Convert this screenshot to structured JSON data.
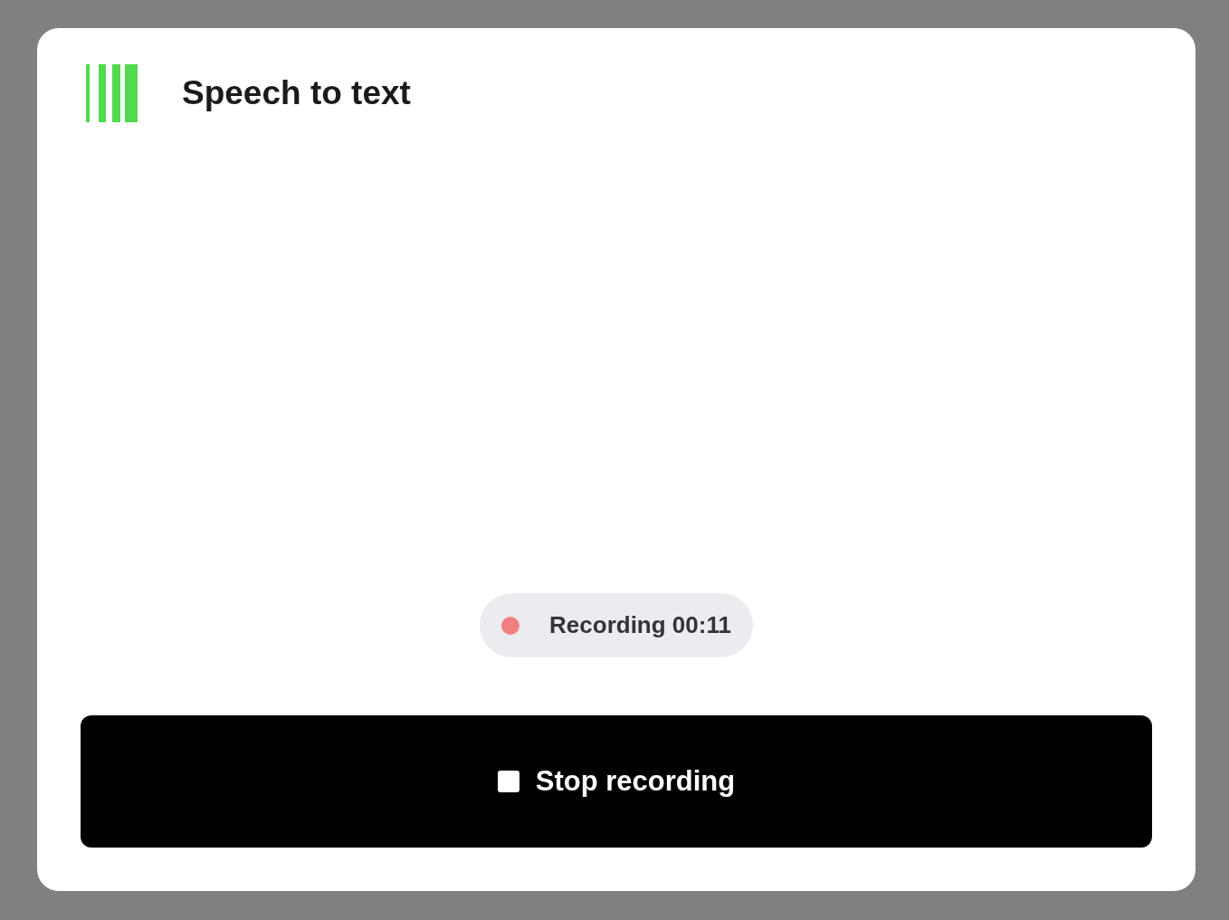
{
  "header": {
    "title": "Speech to text"
  },
  "recording_status": {
    "text": "Recording 00:11"
  },
  "stop_button": {
    "label": "Stop recording"
  }
}
